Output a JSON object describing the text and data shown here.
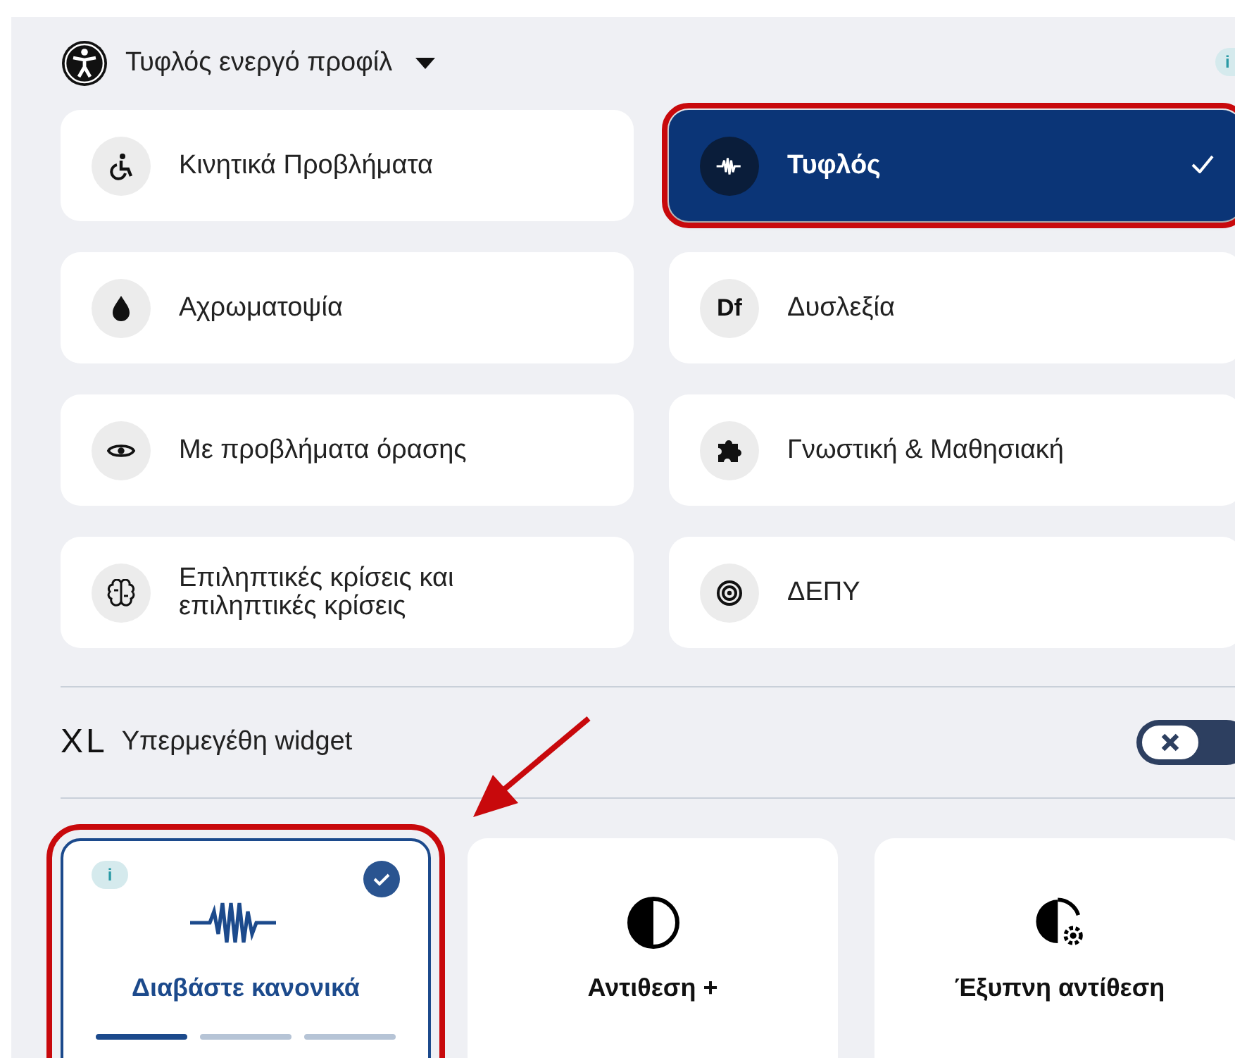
{
  "header": {
    "title": "Τυφλός ενεργό προφίλ",
    "info_badge": "i"
  },
  "profiles": [
    {
      "label": "Κινητικά Προβλήματα",
      "kind": "wheelchair",
      "selected": false,
      "highlighted": false
    },
    {
      "label": "Τυφλός",
      "kind": "wave",
      "selected": true,
      "highlighted": true
    },
    {
      "label": "Αχρωματοψία",
      "kind": "drop",
      "selected": false,
      "highlighted": false
    },
    {
      "label": "Δυσλεξία",
      "kind": "text",
      "icon_text": "Df",
      "selected": false,
      "highlighted": false
    },
    {
      "label": "Με προβλήματα όρασης",
      "kind": "eye",
      "selected": false,
      "highlighted": false
    },
    {
      "label": "Γνωστική & Μαθησιακή",
      "kind": "puzzle",
      "selected": false,
      "highlighted": false
    },
    {
      "label": "Επιληπτικές κρίσεις και επιληπτικές κρίσεις",
      "kind": "brain",
      "selected": false,
      "highlighted": false
    },
    {
      "label": "ΔΕΠΥ",
      "kind": "target",
      "selected": false,
      "highlighted": false
    }
  ],
  "xl_widget": {
    "badge": "XL",
    "label": "Υπερμεγέθη widget",
    "on": false
  },
  "cards": [
    {
      "label": "Διαβάστε κανονικά",
      "kind": "wave",
      "selected": true,
      "highlighted": true,
      "info_badge": "i",
      "steps": [
        {
          "selected": true
        },
        {
          "selected": false
        },
        {
          "selected": false
        }
      ]
    },
    {
      "label": "Αντιθεση +",
      "kind": "contrast",
      "selected": false,
      "highlighted": false
    },
    {
      "label": "Έξυπνη αντίθεση",
      "kind": "smart",
      "selected": false,
      "highlighted": false
    }
  ]
}
